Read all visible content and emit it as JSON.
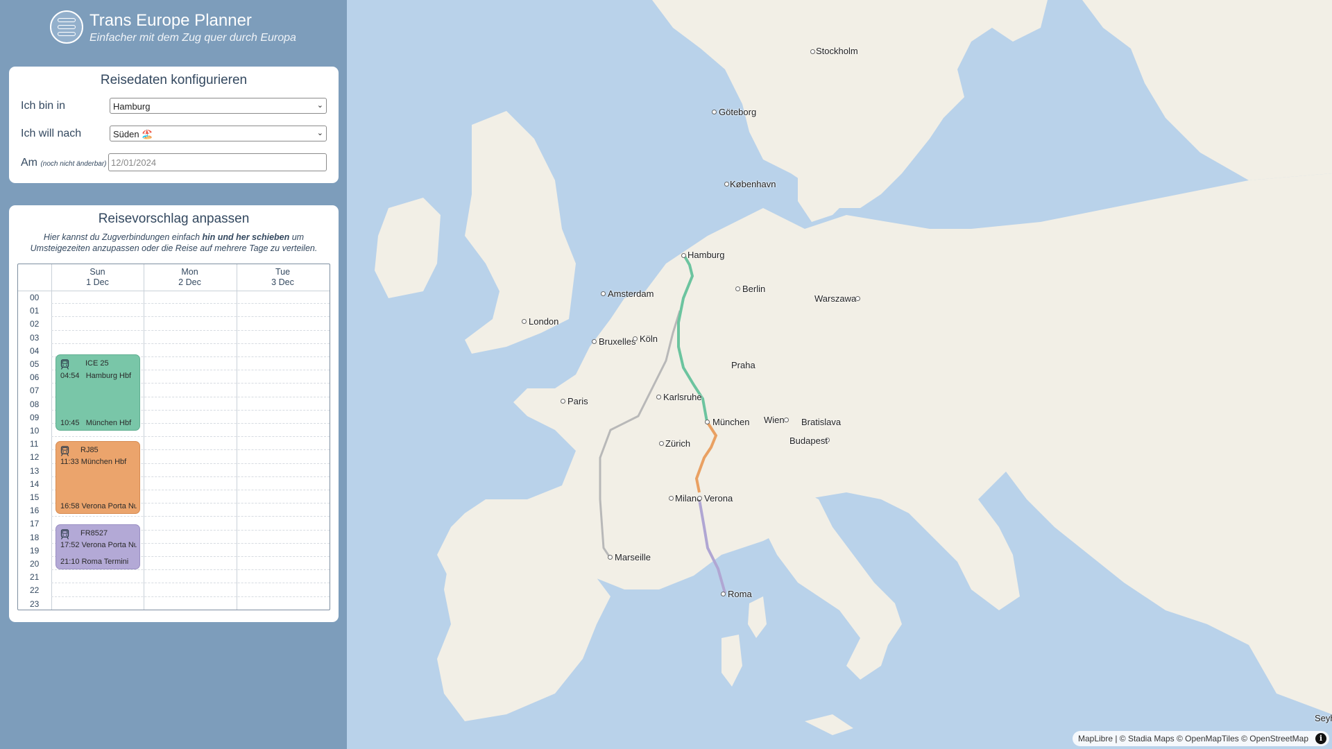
{
  "app": {
    "title": "Trans Europe Planner",
    "subtitle": "Einfacher mit dem Zug quer durch Europa",
    "logo_text": [
      "TRANS",
      "EUROPE",
      "PLANNER"
    ]
  },
  "config": {
    "title": "Reisedaten konfigurieren",
    "from_label": "Ich bin in",
    "from_value": "Hamburg",
    "to_label": "Ich will nach",
    "to_value": "Süden 🏖️",
    "date_label": "Am",
    "date_note": "(noch nicht änderbar)",
    "date_placeholder": "12/01/2024"
  },
  "schedule": {
    "title": "Reisevorschlag anpassen",
    "instruction_pre": "Hier kannst du Zugverbindungen einfach ",
    "instruction_bold": "hin und her schieben",
    "instruction_post": " um Umsteigezeiten anzupassen oder die Reise auf mehrere Tage zu verteilen.",
    "days": [
      {
        "weekday": "Sun",
        "date": "1 Dec"
      },
      {
        "weekday": "Mon",
        "date": "2 Dec"
      },
      {
        "weekday": "Tue",
        "date": "3 Dec"
      }
    ],
    "hours": [
      "00",
      "01",
      "02",
      "03",
      "04",
      "05",
      "06",
      "07",
      "08",
      "09",
      "10",
      "11",
      "12",
      "13",
      "14",
      "15",
      "16",
      "17",
      "18",
      "19",
      "20",
      "21",
      "22",
      "23"
    ],
    "connections": [
      {
        "name": "ICE 25",
        "dep_time": "04:54",
        "dep_station": "Hamburg Hbf",
        "arr_time": "10:45",
        "arr_station": "München Hbf",
        "color": "#79c6a8"
      },
      {
        "name": "RJ85",
        "dep_time": "11:33",
        "dep_station": "München Hbf",
        "arr_time": "16:58",
        "arr_station": "Verona Porta Nuova",
        "color": "#eba46c"
      },
      {
        "name": "FR8527",
        "dep_time": "17:52",
        "dep_station": "Verona Porta Nuova",
        "arr_time": "21:10",
        "arr_station": "Roma Termini",
        "color": "#b3a9d6"
      }
    ]
  },
  "map": {
    "cities": [
      "Stockholm",
      "Göteborg",
      "København",
      "Hamburg",
      "Berlin",
      "Warszawa",
      "Amsterdam",
      "London",
      "Bruxelles",
      "Köln",
      "Praha",
      "Paris",
      "Karlsruhe",
      "München",
      "Wien",
      "Bratislava",
      "Zürich",
      "Budapest",
      "Milano",
      "Verona",
      "Marseille",
      "Roma",
      "Seyh"
    ],
    "attribution": "MapLibre | © Stadia Maps © OpenMapTiles © OpenStreetMap",
    "info_icon": "i",
    "route_colors": {
      "ice": "#6cc49f",
      "rj": "#e9a062",
      "fr": "#b0a6d3",
      "alt": "#b8b8b8"
    }
  }
}
